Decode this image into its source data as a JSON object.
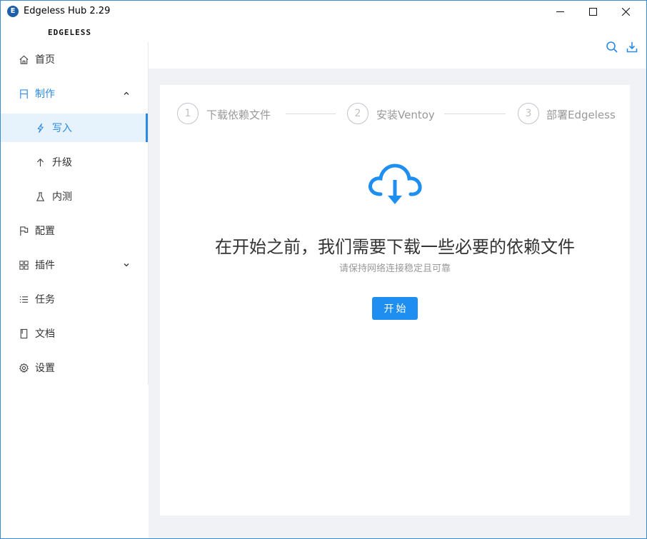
{
  "window": {
    "title": "Edgeless Hub 2.29",
    "app_icon_letter": "E",
    "minimize_icon": "minimize-icon",
    "maximize_icon": "maximize-icon",
    "close_icon": "close-icon"
  },
  "sidebar": {
    "logo": "EDGELESS",
    "items": [
      {
        "label": "首页",
        "icon": "home-icon"
      },
      {
        "label": "制作",
        "icon": "flag-icon",
        "expanded": true
      },
      {
        "label": "写入",
        "icon": "lightning-icon",
        "selected": true
      },
      {
        "label": "升级",
        "icon": "arrow-up-icon"
      },
      {
        "label": "内测",
        "icon": "flask-icon"
      },
      {
        "label": "配置",
        "icon": "config-flag-icon"
      },
      {
        "label": "插件",
        "icon": "grid-icon",
        "expanded": false
      },
      {
        "label": "任务",
        "icon": "list-icon"
      },
      {
        "label": "文档",
        "icon": "document-icon"
      },
      {
        "label": "设置",
        "icon": "gear-icon"
      }
    ]
  },
  "header": {
    "search_icon": "search-icon",
    "download_icon": "download-icon"
  },
  "steps": [
    {
      "number": "1",
      "label": "下载依赖文件"
    },
    {
      "number": "2",
      "label": "安装Ventoy"
    },
    {
      "number": "3",
      "label": "部署Edgeless"
    }
  ],
  "main": {
    "cloud_icon": "cloud-download-icon",
    "headline": "在开始之前，我们需要下载一些必要的依赖文件",
    "subline": "请保持网络连接稳定且可靠",
    "start_button": "开始"
  },
  "colors": {
    "accent": "#1e8ff0",
    "selected_bg": "#e6f3fd",
    "content_bg": "#f0f2f5"
  }
}
